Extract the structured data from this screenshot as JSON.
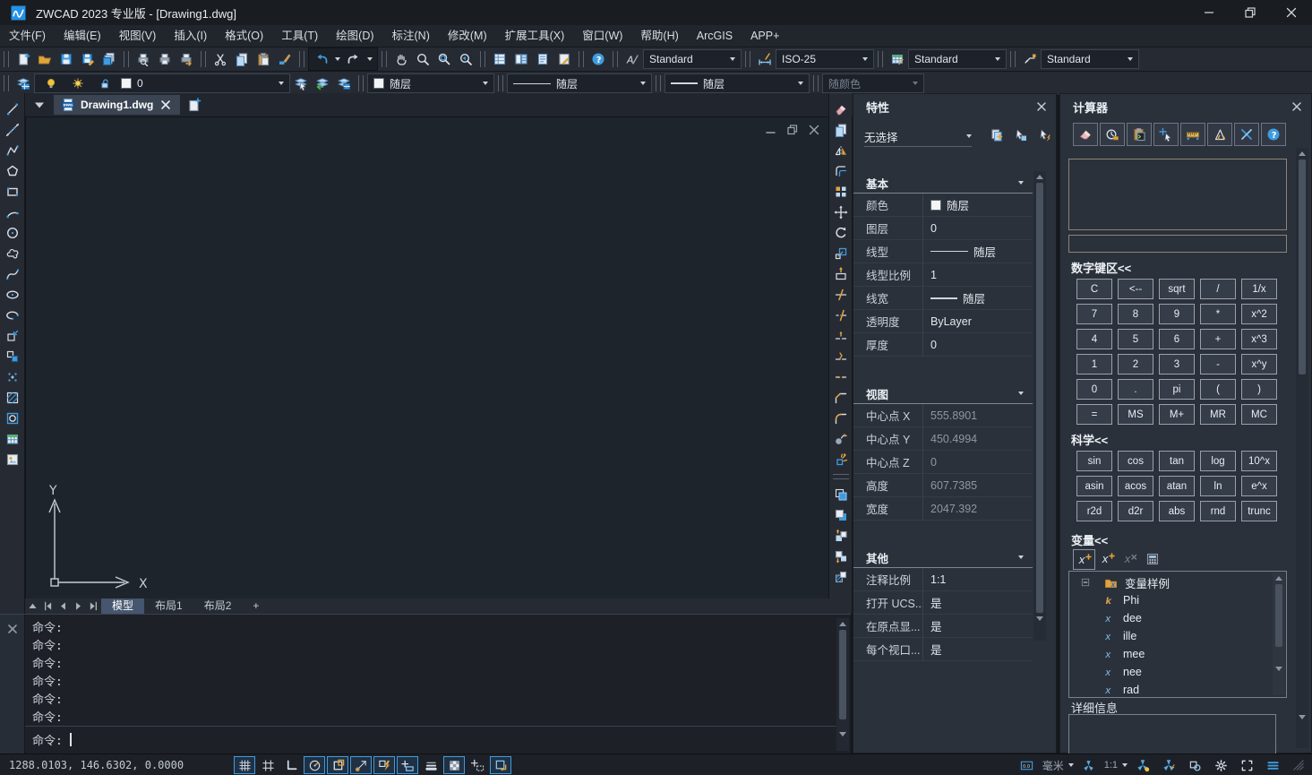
{
  "window": {
    "title": "ZWCAD 2023 专业版 - [Drawing1.dwg]"
  },
  "menu_items": [
    "文件(F)",
    "编辑(E)",
    "视图(V)",
    "插入(I)",
    "格式(O)",
    "工具(T)",
    "绘图(D)",
    "标注(N)",
    "修改(M)",
    "扩展工具(X)",
    "窗口(W)",
    "帮助(H)",
    "ArcGIS",
    "APP+"
  ],
  "toolbar_file_groups": [
    [
      "new-file",
      "open-file",
      "save-file",
      "save-as",
      "save-all"
    ],
    [
      "plot-preview",
      "plot",
      "batch-plot"
    ],
    [
      "cut",
      "copy",
      "paste",
      "match-properties"
    ],
    [
      "undo",
      "redo"
    ],
    [
      "pan",
      "zoom-realtime",
      "zoom-window",
      "zoom-previous"
    ],
    [
      "properties-palette",
      "design-center",
      "tool-palettes",
      "markup"
    ],
    [
      "help"
    ]
  ],
  "style_combos": [
    {
      "icon": "text-style",
      "value": "Standard"
    },
    {
      "icon": "dim-style",
      "value": "ISO-25"
    },
    {
      "icon": "table-style",
      "value": "Standard"
    },
    {
      "icon": "mleader-style",
      "value": "Standard"
    }
  ],
  "layers_toolbar": {
    "current_layer": "0",
    "buttons": [
      "layer-current",
      "layer-previous",
      "layer-states"
    ]
  },
  "property_combos": [
    {
      "name": "color",
      "value": "随层",
      "swatch": "#f2f4f6"
    },
    {
      "name": "linetype",
      "value": "随层",
      "line": "long"
    },
    {
      "name": "lineweight",
      "value": "随层",
      "line": "short"
    },
    {
      "name": "plot-style",
      "value": "随颜色",
      "disabled": true
    }
  ],
  "doc_tab": {
    "title": "Drawing1.dwg"
  },
  "draw_tools": [
    "line",
    "construction-line",
    "polyline",
    "polygon",
    "rectangle",
    "arc",
    "circle",
    "revision-cloud",
    "spline",
    "ellipse",
    "ellipse-arc",
    "insert-block",
    "make-block",
    "point",
    "hatch",
    "region",
    "table",
    "mtext"
  ],
  "modify_tools": [
    "erase",
    "copy-object",
    "mirror",
    "offset",
    "array",
    "move",
    "rotate",
    "scale",
    "stretch",
    "trim",
    "extend",
    "break-at-point",
    "break",
    "join",
    "chamfer",
    "fillet",
    "blend",
    "explode"
  ],
  "draworder_tools": [
    "bring-to-front",
    "send-to-back",
    "bring-above-objects",
    "send-under-objects",
    "hatch-to-back"
  ],
  "properties_panel": {
    "title": "特性",
    "selection": "无选择",
    "toolbar": [
      "quick-select",
      "select-objects",
      "toggle-pickadd"
    ],
    "sections": [
      {
        "title": "基本",
        "rows": [
          {
            "label": "颜色",
            "value": "随层",
            "swatch": "#f2f4f6"
          },
          {
            "label": "图层",
            "value": "0"
          },
          {
            "label": "线型",
            "value": "随层",
            "line": "long"
          },
          {
            "label": "线型比例",
            "value": "1"
          },
          {
            "label": "线宽",
            "value": "随层",
            "line": "short"
          },
          {
            "label": "透明度",
            "value": "ByLayer"
          },
          {
            "label": "厚度",
            "value": "0"
          }
        ]
      },
      {
        "title": "视图",
        "rows": [
          {
            "label": "中心点 X",
            "value": "555.8901",
            "readonly": true
          },
          {
            "label": "中心点 Y",
            "value": "450.4994",
            "readonly": true
          },
          {
            "label": "中心点 Z",
            "value": "0",
            "readonly": true
          },
          {
            "label": "高度",
            "value": "607.7385",
            "readonly": true
          },
          {
            "label": "宽度",
            "value": "2047.392",
            "readonly": true
          }
        ]
      },
      {
        "title": "其他",
        "rows": [
          {
            "label": "注释比例",
            "value": "1:1"
          },
          {
            "label": "打开 UCS...",
            "value": "是"
          },
          {
            "label": "在原点显...",
            "value": "是"
          },
          {
            "label": "每个视口...",
            "value": "是"
          }
        ]
      }
    ]
  },
  "calculator_panel": {
    "title": "计算器",
    "toolbar": [
      "calc-clear",
      "calc-history",
      "calc-paste",
      "calc-get-coordinates",
      "calc-measure-distance",
      "calc-measure-angle",
      "calc-intersection",
      "calc-help"
    ],
    "numpad_title": "数字键区<<",
    "numpad": [
      [
        "C",
        "<--",
        "sqrt",
        "/",
        "1/x"
      ],
      [
        "7",
        "8",
        "9",
        "*",
        "x^2"
      ],
      [
        "4",
        "5",
        "6",
        "+",
        "x^3"
      ],
      [
        "1",
        "2",
        "3",
        "-",
        "x^y"
      ],
      [
        "0",
        ".",
        "pi",
        "(",
        ")"
      ],
      [
        "=",
        "MS",
        "M+",
        "MR",
        "MC"
      ]
    ],
    "scientific_title": "科学<<",
    "scientific": [
      [
        "sin",
        "cos",
        "tan",
        "log",
        "10^x"
      ],
      [
        "asin",
        "acos",
        "atan",
        "ln",
        "e^x"
      ],
      [
        "r2d",
        "d2r",
        "abs",
        "rnd",
        "trunc"
      ]
    ],
    "variables_title": "变量<<",
    "variables_toolbar": [
      "new-variable",
      "edit-variable",
      "delete-variable",
      "calc-return"
    ],
    "variables_root": "变量样例",
    "variables": [
      {
        "type": "k",
        "name": "Phi"
      },
      {
        "type": "x",
        "name": "dee"
      },
      {
        "type": "x",
        "name": "ille"
      },
      {
        "type": "x",
        "name": "mee"
      },
      {
        "type": "x",
        "name": "nee"
      },
      {
        "type": "x",
        "name": "rad"
      }
    ],
    "details_title": "详细信息"
  },
  "layout_bar": {
    "tabs": [
      "模型",
      "布局1",
      "布局2"
    ],
    "active": "模型",
    "add": "+"
  },
  "command_panel": {
    "history": [
      "命令:",
      "命令:",
      "命令:",
      "命令:",
      "命令:",
      "命令:"
    ],
    "prompt": "命令:"
  },
  "status_bar": {
    "coordinates": "1288.0103, 146.6302, 0.0000",
    "toggles": [
      {
        "icon": "sb-grid",
        "name": "grid",
        "on": true
      },
      {
        "icon": "sb-snap",
        "name": "snap",
        "on": false
      },
      {
        "icon": "sb-ortho",
        "name": "ortho",
        "on": false
      },
      {
        "icon": "sb-polar",
        "name": "polar-tracking",
        "on": true
      },
      {
        "icon": "sb-esnap",
        "name": "object-snap",
        "on": true
      },
      {
        "icon": "sb-etrack",
        "name": "object-snap-tracking",
        "on": true
      },
      {
        "icon": "sb-dyn",
        "name": "dynamic-input",
        "on": true
      },
      {
        "icon": "sb-cycle",
        "name": "selection-cycling",
        "on": true
      },
      {
        "icon": "sb-lwt",
        "name": "lineweight-display",
        "on": false
      },
      {
        "icon": "sb-transparency",
        "name": "transparency",
        "on": true
      },
      {
        "icon": "sb-ducs",
        "name": "dynamic-ucs",
        "on": false
      },
      {
        "icon": "sb-annomon",
        "name": "annotation-monitor",
        "on": true
      }
    ],
    "unit_label": "毫米",
    "annotation_scale": "1:1"
  },
  "ucs": {
    "x_label": "X",
    "y_label": "Y"
  }
}
